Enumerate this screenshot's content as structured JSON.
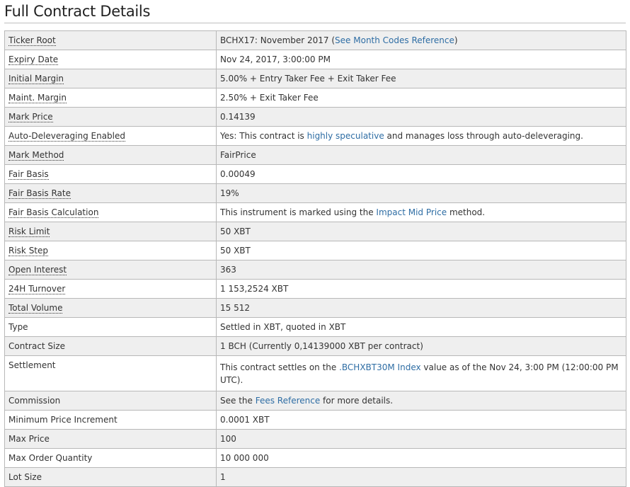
{
  "page": {
    "title": "Full Contract Details"
  },
  "rows": [
    {
      "key": "Ticker Root",
      "tooltip": true,
      "parts": [
        {
          "text": "BCHX17: November 2017 ("
        },
        {
          "text": "See Month Codes Reference",
          "link": true
        },
        {
          "text": ")"
        }
      ]
    },
    {
      "key": "Expiry Date",
      "tooltip": true,
      "parts": [
        {
          "text": "Nov 24, 2017, 3:00:00 PM"
        }
      ]
    },
    {
      "key": "Initial Margin",
      "tooltip": true,
      "parts": [
        {
          "text": "5.00% + Entry Taker Fee + Exit Taker Fee"
        }
      ]
    },
    {
      "key": "Maint. Margin",
      "tooltip": true,
      "parts": [
        {
          "text": "2.50% + Exit Taker Fee"
        }
      ]
    },
    {
      "key": "Mark Price",
      "tooltip": true,
      "parts": [
        {
          "text": "0.14139"
        }
      ]
    },
    {
      "key": "Auto-Deleveraging Enabled",
      "tooltip": true,
      "parts": [
        {
          "text": "Yes: This contract is "
        },
        {
          "text": "highly speculative",
          "link": true
        },
        {
          "text": " and manages loss through auto-deleveraging."
        }
      ]
    },
    {
      "key": "Mark Method",
      "tooltip": true,
      "parts": [
        {
          "text": "FairPrice"
        }
      ]
    },
    {
      "key": "Fair Basis",
      "tooltip": true,
      "parts": [
        {
          "text": "0.00049"
        }
      ]
    },
    {
      "key": "Fair Basis Rate",
      "tooltip": true,
      "parts": [
        {
          "text": "19%"
        }
      ]
    },
    {
      "key": "Fair Basis Calculation",
      "tooltip": true,
      "parts": [
        {
          "text": "This instrument is marked using the "
        },
        {
          "text": "Impact Mid Price",
          "link": true
        },
        {
          "text": " method."
        }
      ]
    },
    {
      "key": "Risk Limit",
      "tooltip": true,
      "parts": [
        {
          "text": "50 XBT"
        }
      ]
    },
    {
      "key": "Risk Step",
      "tooltip": true,
      "parts": [
        {
          "text": "50 XBT"
        }
      ]
    },
    {
      "key": "Open Interest",
      "tooltip": true,
      "parts": [
        {
          "text": "363"
        }
      ]
    },
    {
      "key": "24H Turnover",
      "tooltip": true,
      "parts": [
        {
          "text": "1 153,2524 XBT"
        }
      ]
    },
    {
      "key": "Total Volume",
      "tooltip": true,
      "parts": [
        {
          "text": "15 512"
        }
      ]
    },
    {
      "key": "Type",
      "tooltip": false,
      "parts": [
        {
          "text": "Settled in XBT, quoted in XBT"
        }
      ]
    },
    {
      "key": "Contract Size",
      "tooltip": false,
      "parts": [
        {
          "text": "1 BCH (Currently 0,14139000 XBT per contract)"
        }
      ]
    },
    {
      "key": "Settlement",
      "tooltip": false,
      "tall": true,
      "parts": [
        {
          "text": "This contract settles on the "
        },
        {
          "text": ".BCHXBT30M Index",
          "link": true
        },
        {
          "text": " value as of the Nov 24, 3:00 PM (12:00:00 PM UTC)."
        }
      ]
    },
    {
      "key": "Commission",
      "tooltip": false,
      "parts": [
        {
          "text": "See the "
        },
        {
          "text": "Fees Reference",
          "link": true
        },
        {
          "text": " for more details."
        }
      ]
    },
    {
      "key": "Minimum Price Increment",
      "tooltip": false,
      "parts": [
        {
          "text": "0.0001 XBT"
        }
      ]
    },
    {
      "key": "Max Price",
      "tooltip": false,
      "parts": [
        {
          "text": "100"
        }
      ]
    },
    {
      "key": "Max Order Quantity",
      "tooltip": false,
      "parts": [
        {
          "text": "10 000 000"
        }
      ]
    },
    {
      "key": "Lot Size",
      "tooltip": false,
      "parts": [
        {
          "text": "1"
        }
      ]
    }
  ],
  "colors": {
    "link": "#2e6da4",
    "row_alt": "#efefef",
    "border": "#b8b8b8"
  }
}
